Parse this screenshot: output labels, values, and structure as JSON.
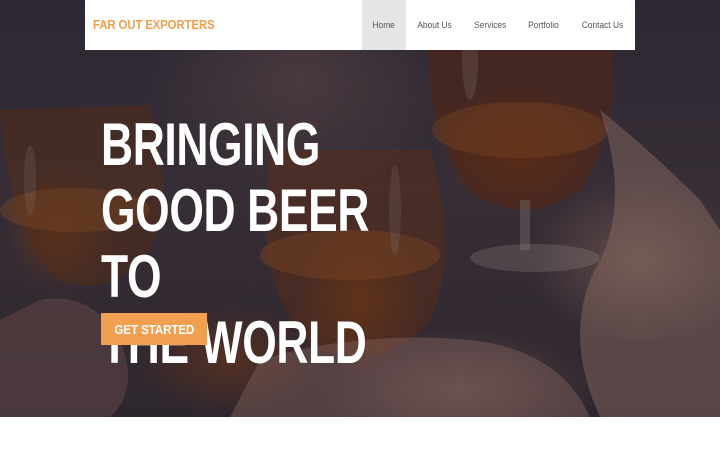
{
  "brand": {
    "name": "FAR OUT EXPORTERS",
    "color": "#f0a050"
  },
  "nav": {
    "items": [
      {
        "label": "Home",
        "active": true
      },
      {
        "label": "About Us",
        "active": false
      },
      {
        "label": "Services",
        "active": false
      },
      {
        "label": "Portfolio",
        "active": false
      },
      {
        "label": "Contact Us",
        "active": false
      }
    ]
  },
  "hero": {
    "headline_lines": [
      "BRINGING",
      "GOOD BEER TO",
      "THE WORLD"
    ],
    "cta_label": "GET STARTED",
    "accent": "#f0a050",
    "background_image": "people toasting glasses of beer"
  }
}
